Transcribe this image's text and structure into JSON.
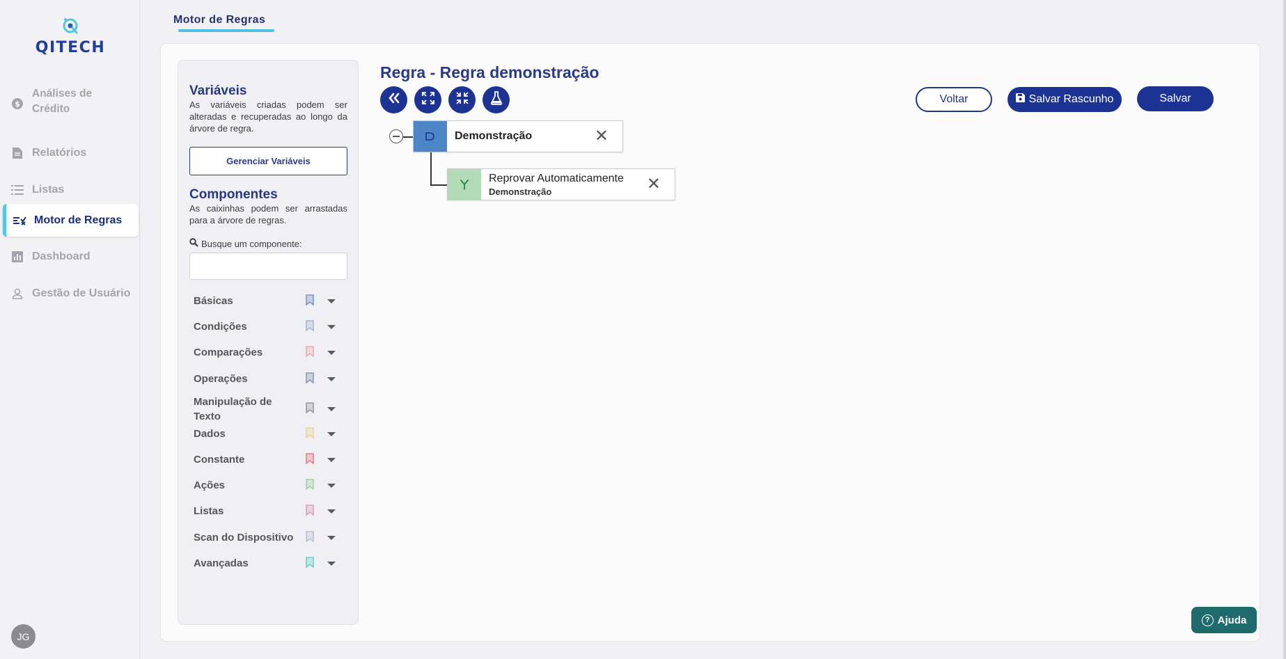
{
  "brand": {
    "name": "QITECH",
    "accent": "#53c6e0",
    "primary": "#1d3393"
  },
  "sidebar": {
    "items": [
      {
        "label": "Análises de Crédito",
        "icon": "dollar-circle-icon",
        "active": false
      },
      {
        "label": "Relatórios",
        "icon": "document-icon",
        "active": false
      },
      {
        "label": "Listas",
        "icon": "list-icon",
        "active": false
      },
      {
        "label": "Motor de Regras",
        "icon": "rules-list-check-icon",
        "active": true
      },
      {
        "label": "Dashboard",
        "icon": "bar-chart-icon",
        "active": false
      },
      {
        "label": "Gestão de Usuário",
        "icon": "user-icon",
        "active": false
      }
    ],
    "avatar": "JG"
  },
  "header": {
    "tab": "Motor de Regras"
  },
  "panel": {
    "variables": {
      "title": "Variáveis",
      "description": "As variáveis criadas podem ser alteradas e recuperadas ao longo da árvore de regra.",
      "button": "Gerenciar Variáveis"
    },
    "components": {
      "title": "Componentes",
      "description": "As caixinhas podem ser arrastadas para a árvore de regras.",
      "search_label": "Busque um componente:",
      "search_placeholder": ""
    },
    "categories": [
      {
        "label": "Básicas",
        "color": "#7e95c9"
      },
      {
        "label": "Condições",
        "color": "#a6b6d6"
      },
      {
        "label": "Comparações",
        "color": "#e9aeb5"
      },
      {
        "label": "Operações",
        "color": "#8a9aad"
      },
      {
        "label": "Manipulação de Texto",
        "color": "#9b9ba2"
      },
      {
        "label": "Dados",
        "color": "#e6d69a"
      },
      {
        "label": "Constante",
        "color": "#e2808d"
      },
      {
        "label": "Ações",
        "color": "#a4cfa6"
      },
      {
        "label": "Listas",
        "color": "#dba3b7"
      },
      {
        "label": "Scan do Dispositivo",
        "color": "#b8c2d6"
      },
      {
        "label": "Avançadas",
        "color": "#6fd1cc"
      }
    ]
  },
  "editor": {
    "title": "Regra - Regra demonstração",
    "tools": [
      "double-chevron-left-icon",
      "expand-icon",
      "collapse-icon",
      "flask-icon"
    ],
    "buttons": {
      "back": "Voltar",
      "save_draft": "Salvar Rascunho",
      "save": "Salvar"
    },
    "nodes": [
      {
        "title": "Demonstração",
        "subtitle": "",
        "icon": "gate-icon",
        "color": "#4d86c6"
      },
      {
        "title": "Reprovar Automaticamente",
        "subtitle": "Demonstração",
        "icon": "fork-icon",
        "color": "#b1dcb5"
      }
    ]
  },
  "help": {
    "label": "Ajuda"
  }
}
